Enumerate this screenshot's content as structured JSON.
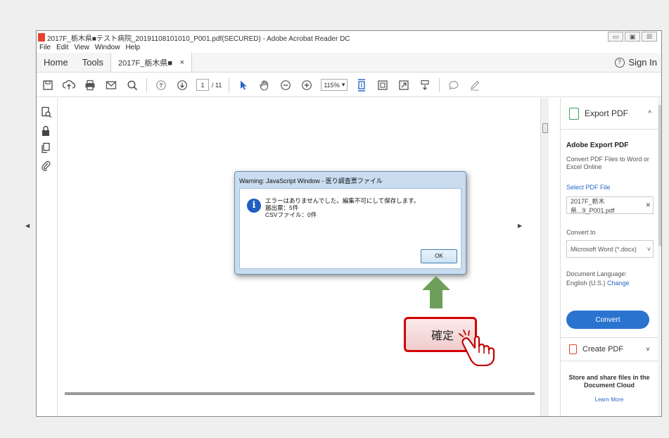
{
  "window": {
    "title": "2017F_栃木県■テスト病院_20191108101010_P001.pdf(SECURED) - Adobe Acrobat Reader DC",
    "controls": [
      "▭",
      "▣",
      "☒"
    ]
  },
  "menu": [
    "File",
    "Edit",
    "View",
    "Window",
    "Help"
  ],
  "tabs": {
    "home": "Home",
    "tools": "Tools",
    "document": "2017F_栃木県■",
    "close": "×",
    "help": "?",
    "signin": "Sign In"
  },
  "toolbar": {
    "page_current": "1",
    "page_total": "/ 11",
    "zoom": "115%",
    "zoom_arrow": "▾"
  },
  "right_pane": {
    "export_header": "Export PDF",
    "header_chevron": "^",
    "title": "Adobe Export PDF",
    "description": "Convert PDF Files to Word or Excel Online",
    "select_link": "Select PDF File",
    "file_name": "2017F_栃木県...9_P001.pdf",
    "file_close": "✕",
    "convert_to_label": "Convert to",
    "convert_to_value": "Microsoft Word (*.docx)",
    "select_chevron": "˅",
    "language_label": "Document Language:",
    "language_value": "English (U.S.)",
    "language_change": "Change",
    "convert_button": "Convert",
    "create_pdf": "Create PDF",
    "create_chevron": "˅",
    "cloud_text": "Store and share files in the Document Cloud",
    "learn_more": "Learn More"
  },
  "dialog": {
    "title": "Warning: JavaScript Window - 医り調査票ファイル",
    "info_glyph": "i",
    "line1": "エラーはありませんでした。編集不可にして保存します。",
    "line2": "届出票：5件",
    "line3": "CSVファイル：0件",
    "ok": "OK"
  },
  "annotation": {
    "label": "確定",
    "arrow_color": "#6e9f5a",
    "border_color": "#d40000"
  }
}
